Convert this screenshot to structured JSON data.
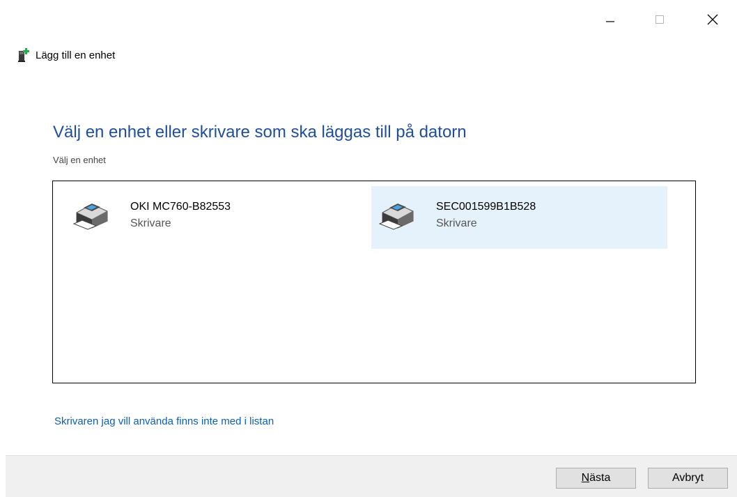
{
  "window": {
    "title": "Lägg till en enhet",
    "controls": {
      "minimize": "minimize-icon",
      "maximize": "maximize-icon",
      "close": "close-icon"
    }
  },
  "main": {
    "heading": "Välj en enhet eller skrivare som ska läggas till på datorn",
    "subheading": "Välj en enhet",
    "devices": [
      {
        "name": "OKI MC760-B82553",
        "type": "Skrivare",
        "icon": "printer-icon",
        "selected": false
      },
      {
        "name": "SEC001599B1B528",
        "type": "Skrivare",
        "icon": "printer-icon",
        "selected": true
      }
    ],
    "missing_link": "Skrivaren jag vill använda finns inte med i listan"
  },
  "footer": {
    "next_accel": "N",
    "next_rest": "ästa",
    "cancel_label": "Avbryt"
  },
  "colors": {
    "heading": "#1f4e9c",
    "link": "#0b5fb5",
    "selection": "#e5f1fb"
  }
}
